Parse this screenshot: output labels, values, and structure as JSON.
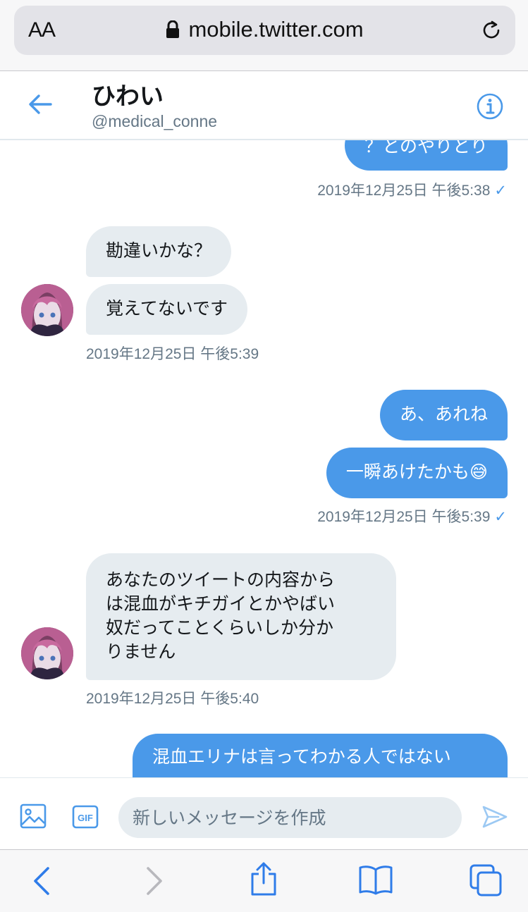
{
  "browser": {
    "text_size_label": "AA",
    "url": "mobile.twitter.com",
    "icons": [
      "lock-icon",
      "reload-icon",
      "back-icon",
      "forward-icon",
      "share-icon",
      "bookmarks-icon",
      "tabs-icon"
    ]
  },
  "header": {
    "name": "ひわい",
    "handle": "@medical_conne",
    "icons": [
      "back-arrow-icon",
      "info-icon"
    ]
  },
  "messages": {
    "sent_partial": "？とのやりとり",
    "sent_partial_time": "2019年12月25日 午後5:38",
    "recv1_a": "勘違いかな？",
    "recv1_b": "覚えてないです",
    "recv1_time": "2019年12月25日 午後5:39",
    "sent2_a": "あ、あれね",
    "sent2_b": "一瞬あけたかも",
    "sent2_emoji": "😅",
    "sent2_time": "2019年12月25日 午後5:39",
    "recv2_line1": "あなたのツイートの内容から",
    "recv2_line2": "は混血がキチガイとかやばい",
    "recv2_line3": "奴だってことくらいしか分か",
    "recv2_line4": "りません",
    "recv2_time": "2019年12月25日 午後5:40",
    "sent3_line1": "混血エリナは言ってわかる人ではない"
  },
  "composer": {
    "placeholder": "新しいメッセージを作成",
    "gif_label": "GIF",
    "icons": [
      "image-icon",
      "gif-icon",
      "send-icon"
    ]
  },
  "colors": {
    "accent": "#4a99e9",
    "received_bubble": "#e6ecf0",
    "meta_text": "#657786"
  }
}
